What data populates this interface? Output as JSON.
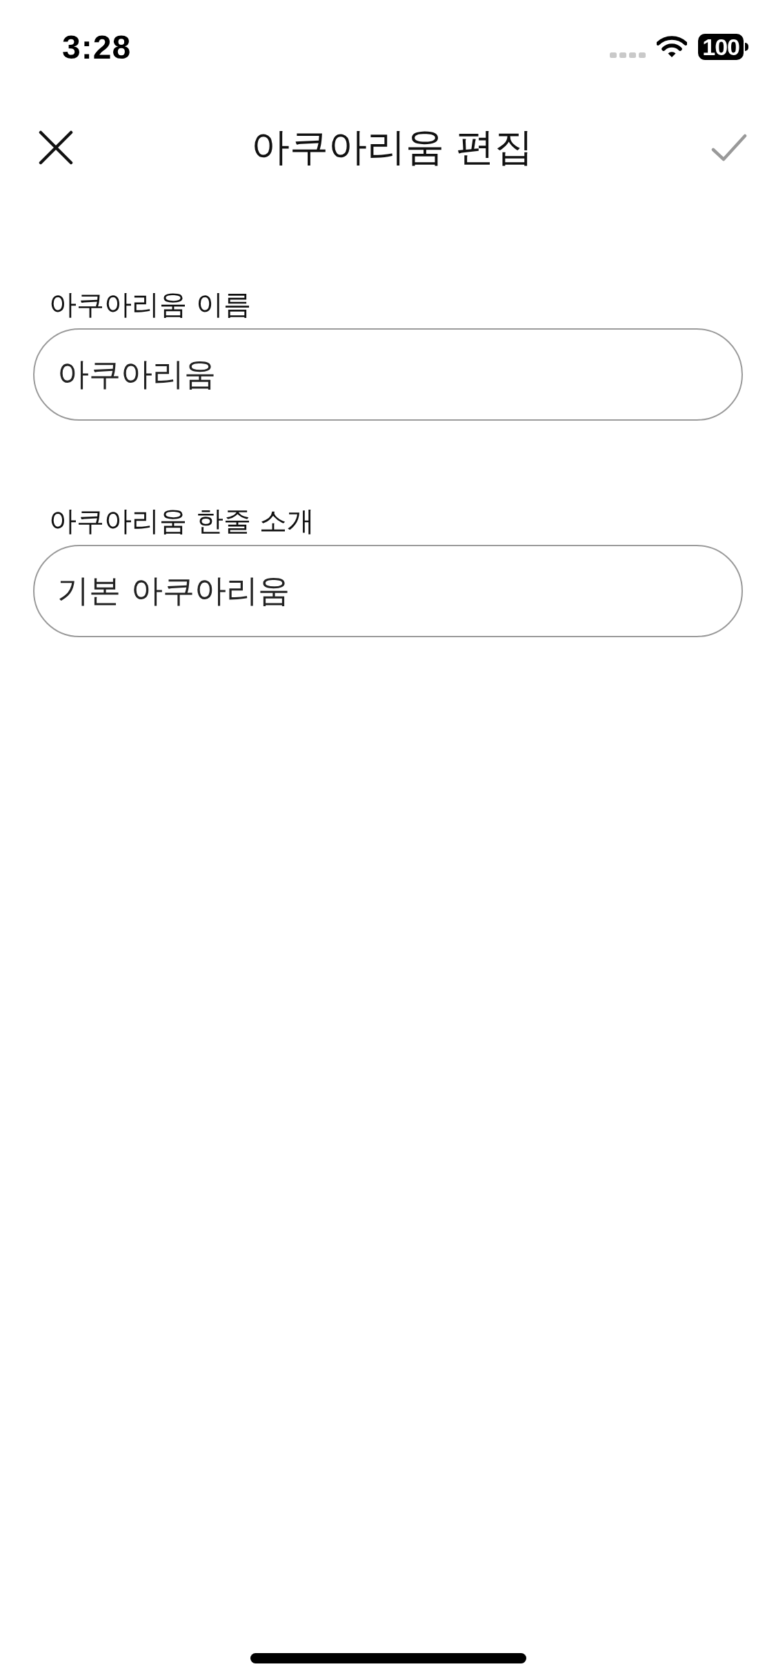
{
  "status_bar": {
    "time": "3:28",
    "battery": "100"
  },
  "header": {
    "title": "아쿠아리움 편집",
    "confirm": {
      "disabled": true
    }
  },
  "fields": [
    {
      "label": "아쿠아리움 이름",
      "value": "아쿠아리움"
    },
    {
      "label": "아쿠아리움 한줄 소개",
      "value": "기본 아쿠아리움"
    }
  ]
}
